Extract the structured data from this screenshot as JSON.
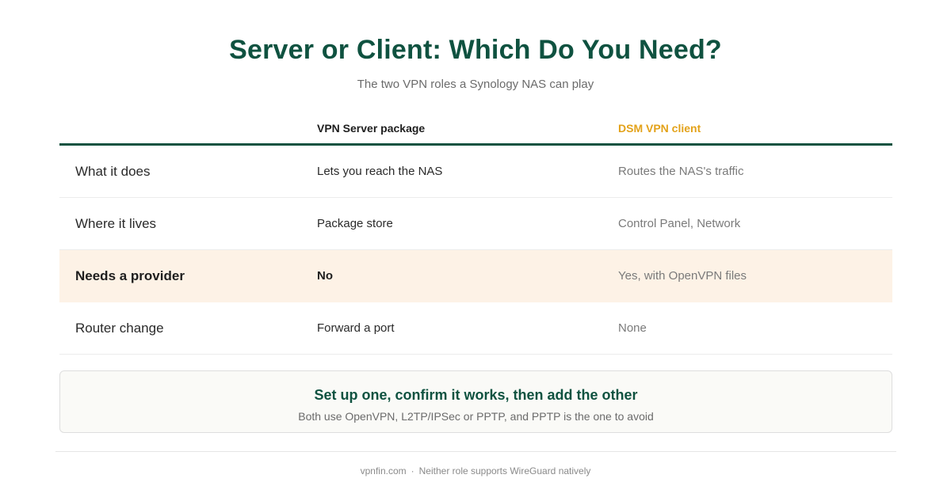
{
  "header": {
    "title": "Server or Client: Which Do You Need?",
    "subtitle": "The two VPN roles a Synology NAS can play"
  },
  "table": {
    "columns": [
      "",
      "VPN Server package",
      "DSM VPN client"
    ],
    "accent_color": "#e3a21a",
    "rows": [
      {
        "label": "What it does",
        "server": "Lets you reach the NAS",
        "client": "Routes the NAS's traffic",
        "highlight": false
      },
      {
        "label": "Where it lives",
        "server": "Package store",
        "client": "Control Panel, Network",
        "highlight": false
      },
      {
        "label": "Needs a provider",
        "server": "No",
        "client": "Yes, with OpenVPN files",
        "highlight": true
      },
      {
        "label": "Router change",
        "server": "Forward a port",
        "client": "None",
        "highlight": false
      }
    ]
  },
  "callout": {
    "title": "Set up one, confirm it works, then add the other",
    "text": "Both use OpenVPN, L2TP/IPSec or PPTP, and PPTP is the one to avoid"
  },
  "footer": {
    "site": "vpnfin.com",
    "separator": "·",
    "note": "Neither role supports WireGuard natively"
  },
  "colors": {
    "brand_green": "#0f5240",
    "highlight_bg": "#fdf2e6"
  }
}
